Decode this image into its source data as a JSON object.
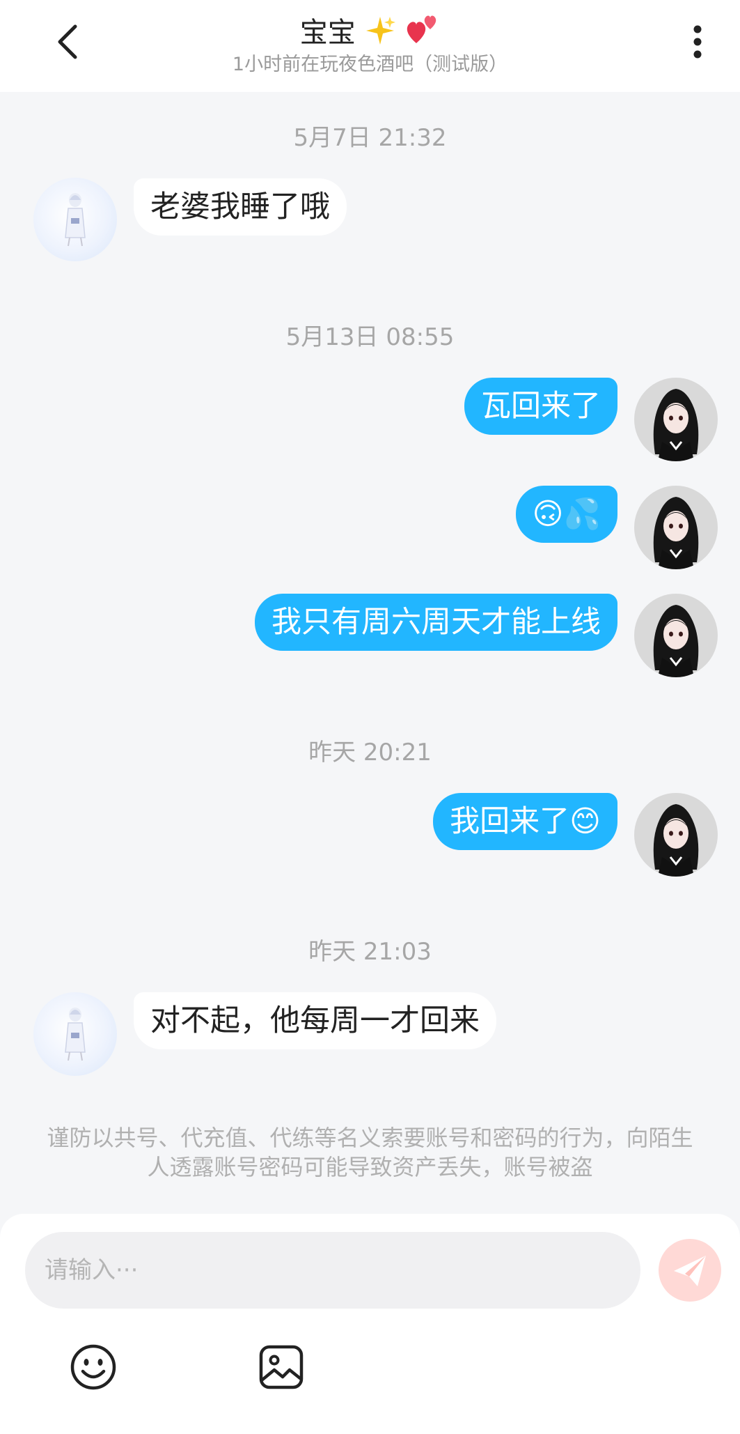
{
  "header": {
    "title": "宝宝",
    "title_icons": [
      "sparkles-icon",
      "two-hearts-icon"
    ],
    "subtitle": "1小时前在玩夜色酒吧（测试版）"
  },
  "messages": [
    {
      "type": "timestamp",
      "text": "5月7日 21:32"
    },
    {
      "type": "incoming",
      "text": "老婆我睡了哦"
    },
    {
      "type": "timestamp",
      "text": "5月13日 08:55"
    },
    {
      "type": "outgoing",
      "text": "瓦回来了"
    },
    {
      "type": "outgoing",
      "text": "🙃💦"
    },
    {
      "type": "outgoing",
      "text": "我只有周六周天才能上线"
    },
    {
      "type": "timestamp",
      "text": "昨天 20:21"
    },
    {
      "type": "outgoing",
      "text": "我回来了😊"
    },
    {
      "type": "timestamp",
      "text": "昨天 21:03"
    },
    {
      "type": "incoming",
      "text": "对不起，他每周一才回来"
    }
  ],
  "notice": "谨防以共号、代充值、代练等名义索要账号和密码的行为，向陌生人透露账号密码可能导致资产丢失，账号被盗",
  "composer": {
    "placeholder": "请输入···",
    "send_icon": "paper-plane-icon"
  },
  "toolbar": [
    "emoji-icon",
    "image-icon"
  ],
  "colors": {
    "outgoing_bubble": "#22b6ff",
    "incoming_bubble": "#ffffff",
    "background": "#f5f6f8",
    "send_button": "#ffd9d6"
  }
}
